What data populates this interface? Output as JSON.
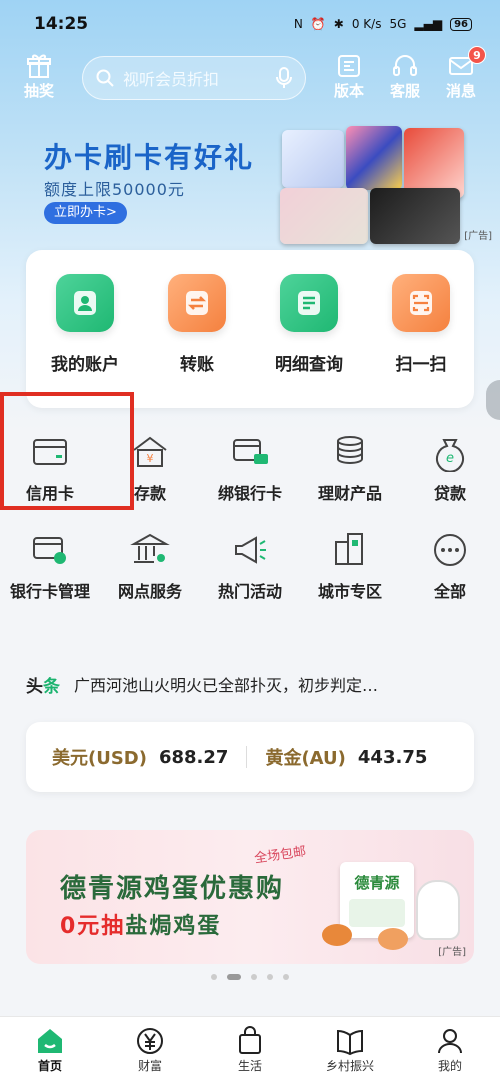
{
  "status": {
    "time": "14:25",
    "net": "0 K/s",
    "signal": "5G",
    "battery": "96"
  },
  "header": {
    "lottery_label": "抽奖",
    "search_placeholder": "视听会员折扣",
    "version_label": "版本",
    "service_label": "客服",
    "message_label": "消息",
    "message_badge": "9"
  },
  "banner": {
    "title": "办卡刷卡有好礼",
    "subtitle": "额度上限50000元",
    "button": "立即办卡>",
    "ad_tag": "[广告]"
  },
  "main_actions": [
    {
      "label": "我的账户",
      "icon": "account-icon",
      "color": "#1fb873"
    },
    {
      "label": "转账",
      "icon": "transfer-icon",
      "color": "#f5813f"
    },
    {
      "label": "明细查询",
      "icon": "detail-icon",
      "color": "#1fb873"
    },
    {
      "label": "扫一扫",
      "icon": "scan-icon",
      "color": "#f5813f"
    }
  ],
  "services_row1": [
    {
      "label": "信用卡",
      "icon": "credit-card-icon"
    },
    {
      "label": "存款",
      "icon": "deposit-icon"
    },
    {
      "label": "绑银行卡",
      "icon": "bind-card-icon"
    },
    {
      "label": "理财产品",
      "icon": "wealth-icon"
    },
    {
      "label": "贷款",
      "icon": "loan-icon"
    }
  ],
  "services_row2": [
    {
      "label": "银行卡管理",
      "icon": "card-manage-icon"
    },
    {
      "label": "网点服务",
      "icon": "branch-icon"
    },
    {
      "label": "热门活动",
      "icon": "megaphone-icon"
    },
    {
      "label": "城市专区",
      "icon": "city-icon"
    },
    {
      "label": "全部",
      "icon": "more-icon"
    }
  ],
  "news": {
    "tag_a": "头",
    "tag_b": "条",
    "text": "广西河池山火明火已全部扑灭，初步判定…"
  },
  "rates": {
    "usd_label": "美元(USD)",
    "usd_value": "688.27",
    "gold_label": "黄金(AU)",
    "gold_value": "443.75"
  },
  "promo": {
    "script": "全场包邮",
    "title": "德青源鸡蛋优惠购",
    "sub_red": "0元抽",
    "sub_rest": "盐焗鸡蛋",
    "brand": "德青源",
    "ad_tag": "[广告]"
  },
  "tabs": [
    {
      "label": "首页",
      "icon": "home-icon"
    },
    {
      "label": "财富",
      "icon": "wealth-yen-icon"
    },
    {
      "label": "生活",
      "icon": "bag-icon"
    },
    {
      "label": "乡村振兴",
      "icon": "book-icon"
    },
    {
      "label": "我的",
      "icon": "profile-icon"
    }
  ],
  "colors": {
    "accent_green": "#1fb873",
    "accent_orange": "#f5813f",
    "highlight_red": "#e02e22"
  }
}
